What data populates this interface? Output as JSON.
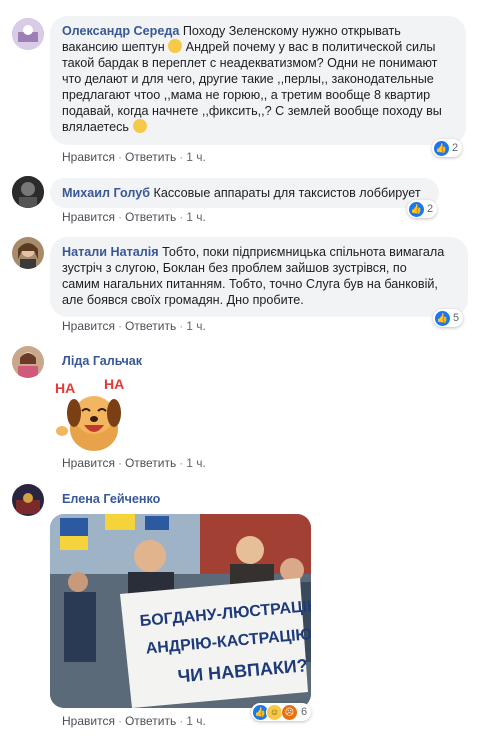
{
  "comments": [
    {
      "author": "Олександр Середа",
      "text_lines": [
        "Походу Зеленскому нужно открывать",
        "вакансию шептун",
        "Андрей почему у вас в политической силы",
        "такой бардак в перeплет с неадекватизмом? Одни не понимают",
        "что делают и для чего, другие такие ,,перлы,, законодательные",
        "предлагают чтоо ,,мама не горюю,, а третим вообще 8 квартир",
        "подавай, когда начнете ,,фиксить,,? С землей вообще походу вы",
        "влялаетесь"
      ],
      "actions": {
        "like": "Нравится",
        "reply": "Ответить",
        "time": "1 ч."
      },
      "reaction_count": "2"
    },
    {
      "author": "Михаил Голуб",
      "text": "Кассовые аппараты для таксистов лоббирует",
      "actions": {
        "like": "Нравится",
        "reply": "Ответить",
        "time": "1 ч."
      },
      "reaction_count": "2"
    },
    {
      "author": "Натали Наталія",
      "text_lines": [
        "Тобто, поки підприємницька спільнота вимагала",
        "зустріч з слугою, Боклан без проблем зайшов зустрівся, по",
        "самим нагальних питанням. Тобто, точно Слуга був на банковій,",
        "але боявся своїх громадян. Дно пробите."
      ],
      "actions": {
        "like": "Нравится",
        "reply": "Ответить",
        "time": "1 ч."
      },
      "reaction_count": "5"
    },
    {
      "author": "Ліда Гальчак",
      "sticker_text": [
        "HA",
        "HA"
      ],
      "actions": {
        "like": "Нравится",
        "reply": "Ответить",
        "time": "1 ч."
      }
    },
    {
      "author": "Елена Гейченко",
      "sign_lines": [
        "БОГДАНУ-ЛЮСТРАЦІЮ",
        "АНДРІЮ-КАСТРАЦІЮ.",
        "ЧИ НАВПАКИ?"
      ],
      "actions": {
        "like": "Нравится",
        "reply": "Ответить",
        "time": "1 ч."
      },
      "reaction_count": "6"
    }
  ]
}
